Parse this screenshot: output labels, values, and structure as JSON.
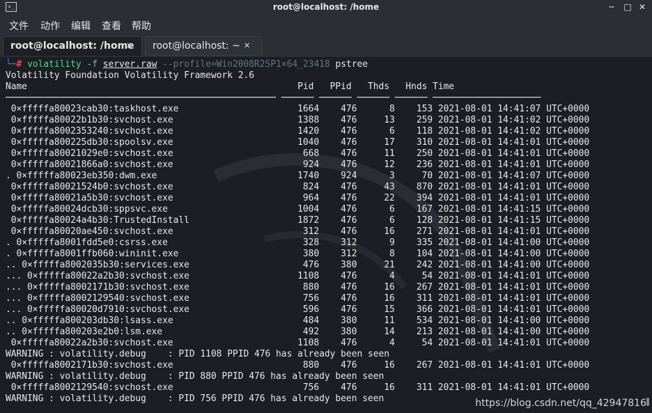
{
  "window": {
    "title": "root@localhost: /home",
    "icon": "terminal-icon",
    "controls": [
      "minimize",
      "maximize",
      "close"
    ]
  },
  "menu": {
    "items": [
      "文件",
      "动作",
      "编辑",
      "查看",
      "帮助"
    ]
  },
  "tabs": [
    {
      "label": "root@localhost: /home",
      "active": true
    },
    {
      "label": "root@localhost: ~",
      "active": false
    }
  ],
  "terminal": {
    "prompt": {
      "corner": "└─",
      "hash": "#",
      "command": "volatility",
      "flag": "-f",
      "file": "server.raw",
      "profile": "--profile=Win2008R2SP1×64_23418",
      "plugin": "pstree"
    },
    "lines": [
      "Volatility Foundation Volatility Framework 2.6",
      "Name                                                  Pid   PPid   Thds   Hnds Time",
      "────────────────────────────────────────────────── ────── ────── ────── ────── ────────────────────",
      " 0×fffffa80023cab30:taskhost.exe                      1664    476      8    153 2021-08-01 14:41:07 UTC+0000",
      " 0×fffffa80022b1b30:svchost.exe                       1388    476     13    259 2021-08-01 14:41:02 UTC+0000",
      " 0×fffffa8002353240:svchost.exe                       1420    476      6    118 2021-08-01 14:41:02 UTC+0000",
      " 0×fffffa800225db30:spoolsv.exe                       1040    476     17    310 2021-08-01 14:41:01 UTC+0000",
      " 0×fffffa80021029e0:svchost.exe                        668    476     11    250 2021-08-01 14:41:01 UTC+0000",
      " 0×fffffa80021866a0:svchost.exe                        924    476     12    236 2021-08-01 14:41:01 UTC+0000",
      ". 0×fffffa80023eb350:dwm.exe                          1740    924      3     70 2021-08-01 14:41:07 UTC+0000",
      " 0×fffffa80021524b0:svchost.exe                        824    476     43    870 2021-08-01 14:41:01 UTC+0000",
      " 0×fffffa80021a5b30:svchost.exe                        964    476     22    394 2021-08-01 14:41:01 UTC+0000",
      " 0×fffffa80024dcb30:sppsvc.exe                        1004    476      6    167 2021-08-01 14:41:15 UTC+0000",
      " 0×fffffa80024a4b30:TrustedInstall                    1872    476      6    128 2021-08-01 14:41:15 UTC+0000",
      " 0×fffffa80020ae450:svchost.exe                        312    476     16    271 2021-08-01 14:41:01 UTC+0000",
      ". 0×fffffa8001fdd5e0:csrss.exe                         328    312      9    335 2021-08-01 14:41:00 UTC+0000",
      ". 0×fffffa8001ffb060:wininit.exe                       380    312      8    104 2021-08-01 14:41:00 UTC+0000",
      ".. 0×fffffa8002035b30:services.exe                     476    380     21    242 2021-08-01 14:41:00 UTC+0000",
      "... 0×fffffa80022a2b30:svchost.exe                    1108    476      4     54 2021-08-01 14:41:01 UTC+0000",
      "... 0×fffffa8002171b30:svchost.exe                     880    476     16    267 2021-08-01 14:41:01 UTC+0000",
      "... 0×fffffa8002129540:svchost.exe                     756    476     16    311 2021-08-01 14:41:01 UTC+0000",
      "... 0×fffffa80020d7910:svchost.exe                     596    476     15    366 2021-08-01 14:41:01 UTC+0000",
      ".. 0×fffffa800203db30:lsass.exe                        484    380     11    534 2021-08-01 14:41:00 UTC+0000",
      ".. 0×fffffa800203e2b0:lsm.exe                          492    380     14    213 2021-08-01 14:41:00 UTC+0000",
      " 0×fffffa80022a2b30:svchost.exe                       1108    476      4     54 2021-08-01 14:41:01 UTC+0000",
      "WARNING : volatility.debug    : PID 1108 PPID 476 has already been seen",
      " 0×fffffa8002171b30:svchost.exe                        880    476     16    267 2021-08-01 14:41:01 UTC+0000",
      "WARNING : volatility.debug    : PID 880 PPID 476 has already been seen",
      " 0×fffffa8002129540:svchost.exe                        756    476     16    311 2021-08-01 14:41:01 UTC+0000",
      "WARNING : volatility.debug    : PID 756 PPID 476 has already been seen"
    ]
  },
  "watermark_text": "https://blog.csdn.net/qq_42947816"
}
